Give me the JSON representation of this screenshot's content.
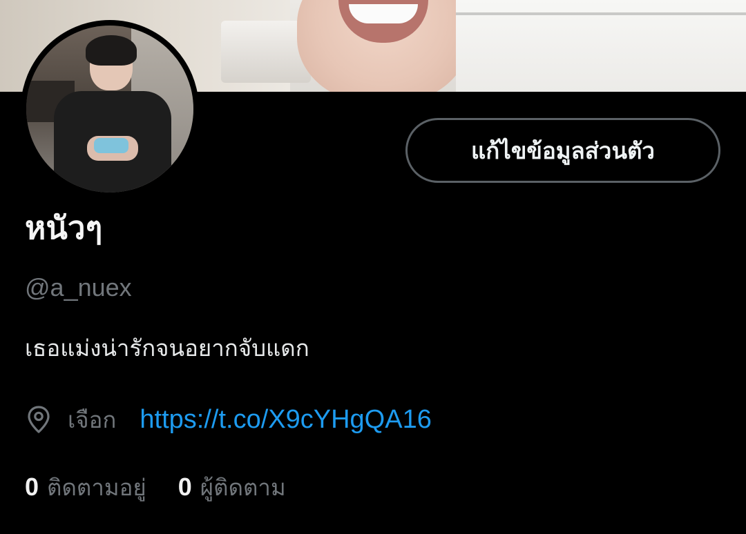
{
  "profile": {
    "display_name": "หนัวๆ",
    "handle": "@a_nuex",
    "bio": "เธอแม่งน่ารักจนอยากจับแดก",
    "location": "เจือก",
    "link": "https://t.co/X9cYHgQA16"
  },
  "actions": {
    "edit_profile_label": "แก้ไขข้อมูลส่วนตัว"
  },
  "stats": {
    "following_count": "0",
    "following_label": "ติดตามอยู่",
    "followers_count": "0",
    "followers_label": "ผู้ติดตาม"
  },
  "icons": {
    "location": "map-pin-icon"
  },
  "colors": {
    "background": "#000000",
    "link": "#1d9bf0",
    "muted_text": "#71767b",
    "button_border": "#5b6166"
  }
}
